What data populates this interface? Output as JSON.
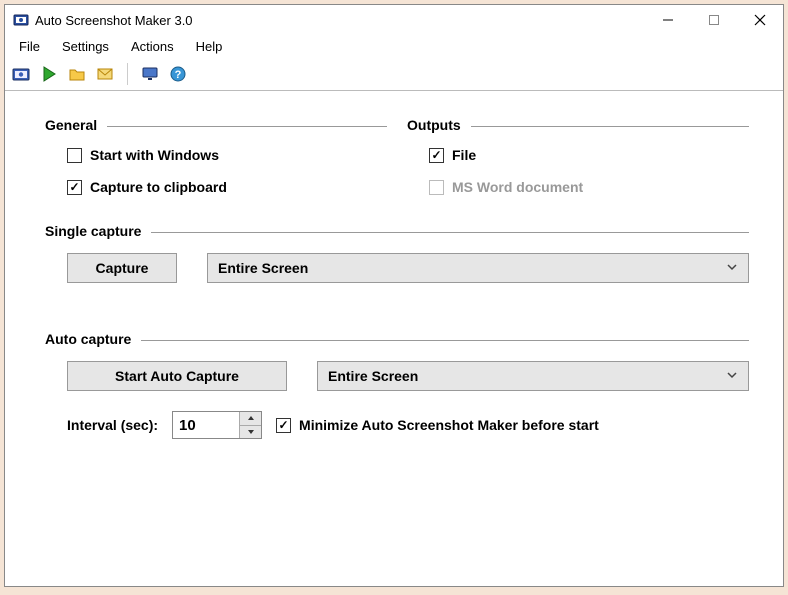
{
  "titlebar": {
    "title": "Auto Screenshot Maker 3.0"
  },
  "menubar": {
    "items": [
      "File",
      "Settings",
      "Actions",
      "Help"
    ]
  },
  "toolbar": {
    "icons": [
      "camera",
      "play",
      "folder",
      "mail",
      "monitor",
      "help"
    ]
  },
  "sections": {
    "general": {
      "legend": "General",
      "start_with_windows": {
        "label": "Start with Windows",
        "checked": false
      },
      "capture_clipboard": {
        "label": "Capture to clipboard",
        "checked": true
      }
    },
    "outputs": {
      "legend": "Outputs",
      "file": {
        "label": "File",
        "checked": true
      },
      "msword": {
        "label": "MS Word document",
        "checked": false,
        "disabled": true
      }
    },
    "single_capture": {
      "legend": "Single capture",
      "capture_button": "Capture",
      "target_selected": "Entire Screen"
    },
    "auto_capture": {
      "legend": "Auto capture",
      "start_button": "Start Auto Capture",
      "target_selected": "Entire Screen",
      "interval_label": "Interval (sec):",
      "interval_value": "10",
      "minimize": {
        "label": "Minimize Auto Screenshot Maker before start",
        "checked": true
      }
    }
  }
}
